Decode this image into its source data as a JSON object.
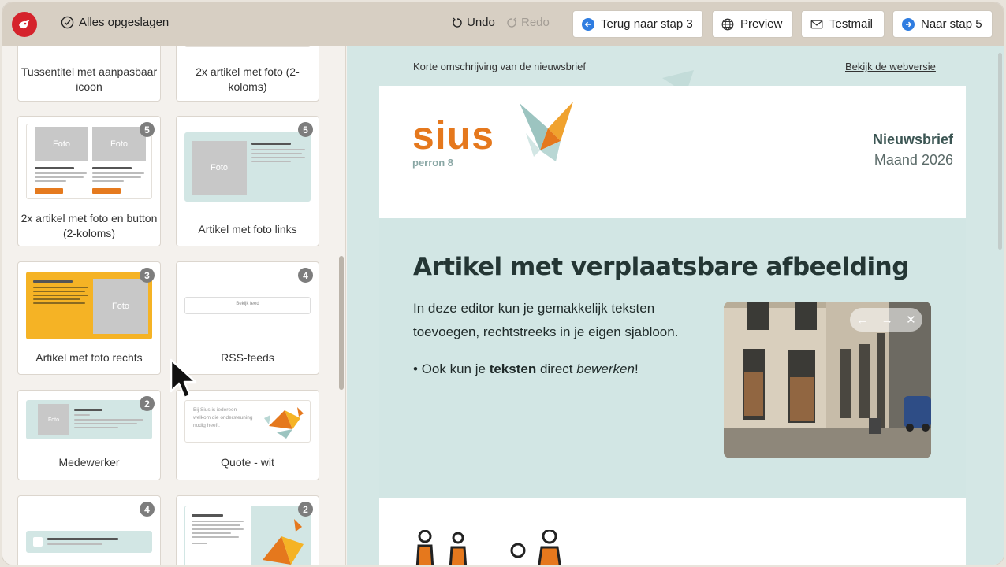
{
  "toolbar": {
    "saved_label": "Alles opgeslagen",
    "undo_label": "Undo",
    "redo_label": "Redo",
    "back_label": "Terug naar stap 3",
    "preview_label": "Preview",
    "testmail_label": "Testmail",
    "next_label": "Naar stap 5"
  },
  "blocks": [
    {
      "label": "Tussentitel met aanpasbaar icoon",
      "badge": ""
    },
    {
      "label": "2x artikel met foto (2-koloms)",
      "badge": ""
    },
    {
      "label": "2x artikel met foto en button (2-koloms)",
      "badge": "5"
    },
    {
      "label": "Artikel met foto links",
      "badge": "5"
    },
    {
      "label": "Artikel met foto rechts",
      "badge": "3"
    },
    {
      "label": "RSS-feeds",
      "badge": "4"
    },
    {
      "label": "Medewerker",
      "badge": "2"
    },
    {
      "label": "Quote - wit",
      "badge": ""
    },
    {
      "label": "",
      "badge": "4"
    },
    {
      "label": "",
      "badge": "2"
    }
  ],
  "thumbs": {
    "foto": "Foto",
    "quote_text": "Bij Sius is iedereen welkom die ondersteuning nodig heeft.",
    "rss_button": "Bekijk feed"
  },
  "newsletter": {
    "short_description": "Korte omschrijving van de nieuwsbrief",
    "webversion_link": "Bekijk de webversie",
    "brand": "sius",
    "brand_sub": "perron 8",
    "title": "Nieuwsbrief",
    "month": "Maand 2026",
    "article_heading": "Artikel met verplaatsbare afbeelding",
    "article_paragraph": "In deze editor kun je gemakkelijk teksten toevoegen, rechtstreeks in je eigen sjabloon.",
    "bullet_prefix": "Ook kun je ",
    "bullet_bold": "teksten",
    "bullet_mid": " direct ",
    "bullet_italic": "bewerken",
    "bullet_suffix": "!",
    "photo_controls": [
      "←",
      "→",
      "✕"
    ]
  },
  "colors": {
    "brand_orange": "#e5781d",
    "teal_bg": "#d4e7e5",
    "logo_red": "#d5232c",
    "accent_blue": "#2f7de1"
  }
}
